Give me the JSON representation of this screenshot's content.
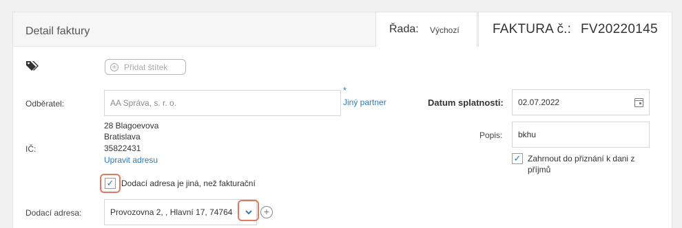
{
  "header": {
    "title": "Detail faktury",
    "rada_label": "Řada:",
    "rada_value": "Výchozí",
    "faktura_label": "FAKTURA č.:",
    "faktura_number": "FV20220145"
  },
  "tags": {
    "add_label": "Přidat štítek"
  },
  "odberatel": {
    "label": "Odběratel:",
    "value": "AA Správa, s. r. o.",
    "other_partner_link": "Jiný partner",
    "required_mark": "*"
  },
  "address": {
    "line1": "28 Blagoevova",
    "line2": "Bratislava",
    "line3": "35822431",
    "ic_label": "IČ:",
    "edit_link": "Upravit adresu"
  },
  "delivery": {
    "checkbox_label": "Dodací adresa je jiná, než fakturační",
    "checkbox_checked": true,
    "label": "Dodací adresa:",
    "select_value": "Provozovna 2, , Hlavní 17, 74764"
  },
  "due_date": {
    "label": "Datum splatnosti:",
    "value": "02.07.2022"
  },
  "popis": {
    "label": "Popis:",
    "value": "bkhu"
  },
  "tax": {
    "checkbox_label_line1": "Zahrnout do přiznání k dani z",
    "checkbox_label_line2": "příjmů",
    "checkbox_checked": true
  },
  "colors": {
    "accent": "#2f7ab8",
    "highlight": "#e07a5f"
  },
  "icons": {
    "tags": "tags-icon",
    "calendar": "calendar-icon",
    "chevron": "chevron-down-icon",
    "add": "plus-circle-icon"
  }
}
